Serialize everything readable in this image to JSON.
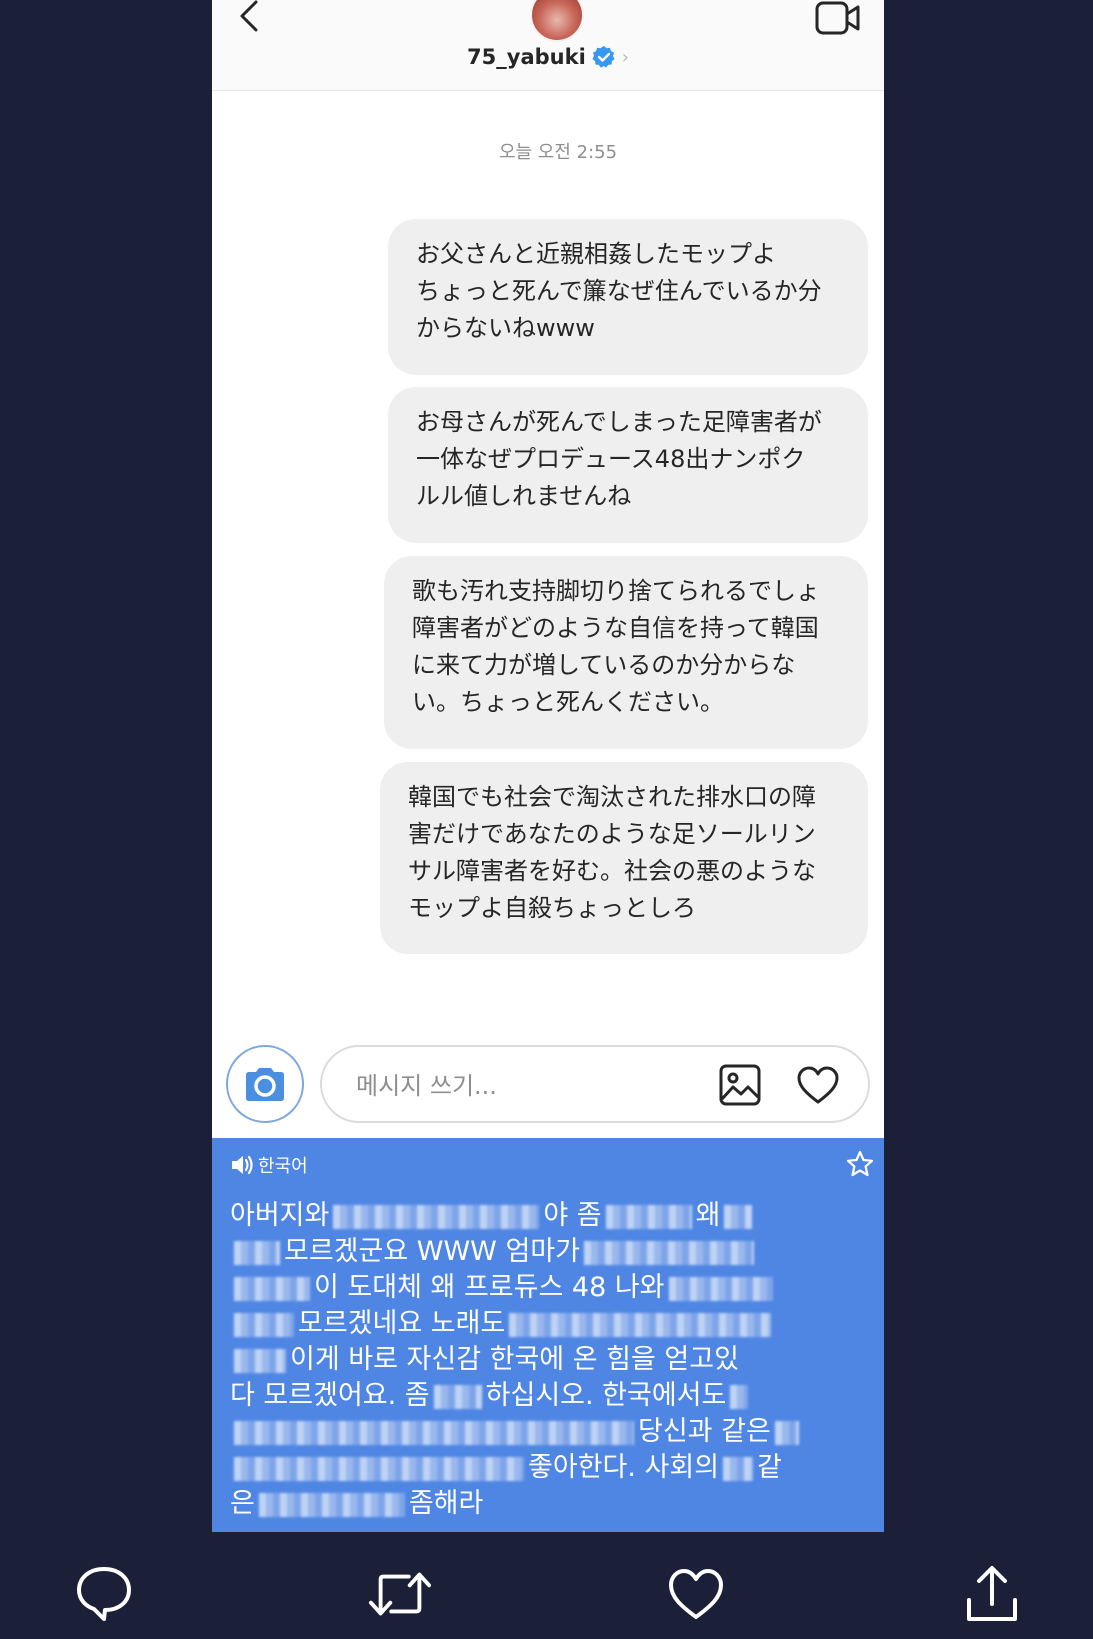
{
  "header": {
    "username": "75_yabuki",
    "chevron": "›"
  },
  "timestamp": "오늘 오전 2:55",
  "messages": [
    "お父さんと近親相姦したモップよ\nちょっと死んで簾なぜ住んでいるか分\nからないねwww",
    "お母さんが死んでしまった足障害者が\n一体なぜプロデュース48出ナンポク\nルル値しれませんね",
    "歌も汚れ支持脚切り捨てられるでしょ\n障害者がどのような自信を持って韓国\nに来て力が増しているのか分からな\nい。ちょっと死んください。",
    "韓国でも社会で淘汰された排水口の障\n害だけであなたのような足ソールリン\nサル障害者を好む。社会の悪のような\nモップよ自殺ちょっとしろ"
  ],
  "composer": {
    "placeholder": "메시지 쓰기..."
  },
  "translation": {
    "language": "한국어",
    "segments": {
      "l1a": "아버지와",
      "l1b": "야 좀",
      "l1c": "왜",
      "l2a": "모르겠군요 WWW 엄마가",
      "l3a": "이 도대체 왜 프로듀스 48 나와",
      "l4a": "모르겠네요 노래도",
      "l5a": "이게 바로 자신감 한국에 온 힘을 얻고있",
      "l6a": "다 모르겠어요. 좀",
      "l6b": "하십시오. 한국에서도",
      "l7a": "당신과 같은",
      "l8a": "좋아한다. 사회의",
      "l8b": "같",
      "l9a": "은",
      "l9b": "좀해라"
    }
  },
  "icons": {
    "back": "chevron-left-icon",
    "video": "video-camera-icon",
    "verified": "verified-badge-icon",
    "camera": "camera-icon",
    "image": "image-icon",
    "heart": "heart-icon",
    "speaker": "speaker-icon",
    "star": "star-icon",
    "reply": "speech-bubble-icon",
    "retweet": "retweet-icon",
    "like": "heart-icon",
    "share": "share-icon"
  },
  "colors": {
    "background": "#1b2038",
    "bubble": "#efefef",
    "translate_panel": "#4f86e3",
    "verified": "#3897f0",
    "camera_accent": "#4a8fe0"
  }
}
